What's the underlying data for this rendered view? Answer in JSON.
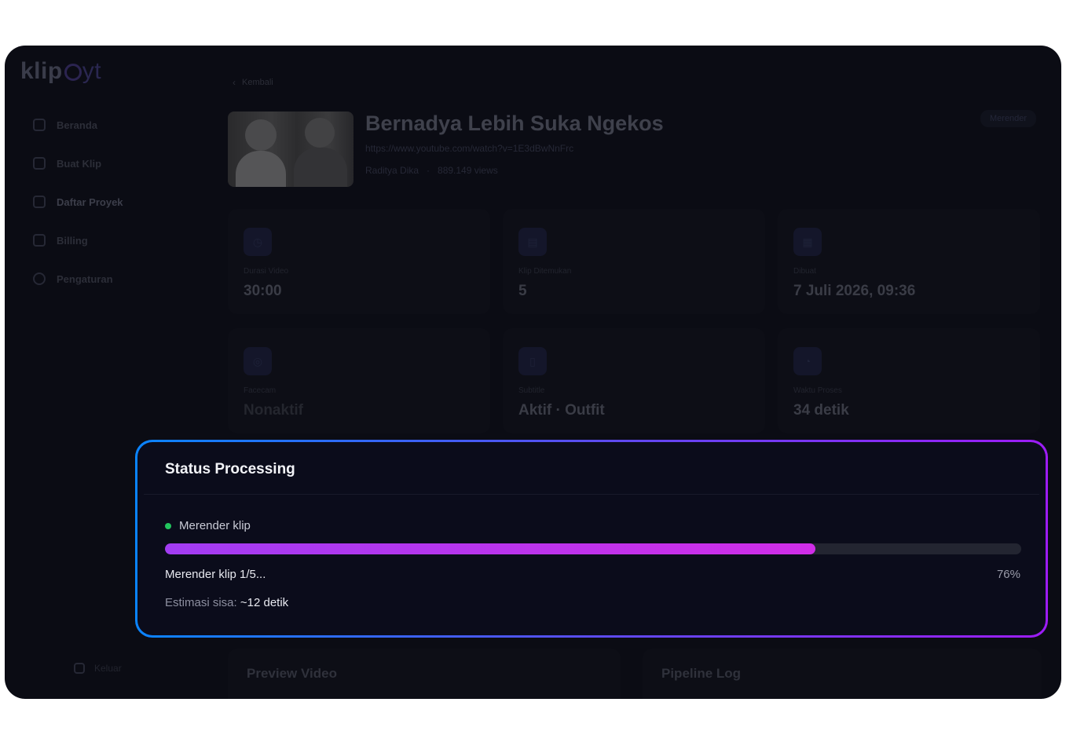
{
  "sidebar": {
    "logo_text": "klip",
    "logo_suffix": "yt",
    "items": [
      {
        "label": "Beranda",
        "icon": "home-icon"
      },
      {
        "label": "Buat Klip",
        "icon": "video-icon"
      },
      {
        "label": "Daftar Proyek",
        "icon": "folder-icon"
      },
      {
        "label": "Billing",
        "icon": "card-icon"
      },
      {
        "label": "Pengaturan",
        "icon": "gear-icon"
      }
    ],
    "logout_label": "Keluar"
  },
  "header": {
    "back_label": "Kembali",
    "video_title": "Bernadya Lebih Suka Ngekos",
    "video_url": "https://www.youtube.com/watch?v=1E3dBwNnFrc",
    "channel": "Raditya Dika",
    "views": "889.149 views",
    "status_badge": "Merender"
  },
  "stats": [
    {
      "label": "Durasi Video",
      "value": "30:00",
      "icon": "clock-icon"
    },
    {
      "label": "Klip Ditemukan",
      "value": "5",
      "icon": "film-icon"
    },
    {
      "label": "Dibuat",
      "value": "7 Juli 2026, 09:36",
      "icon": "calendar-icon"
    },
    {
      "label": "Facecam",
      "value": "Nonaktif",
      "icon": "camera-icon"
    },
    {
      "label": "Subtitle",
      "value": "Aktif · Outfit",
      "icon": "document-icon"
    },
    {
      "label": "Waktu Proses",
      "value": "34 detik",
      "icon": "timer-icon"
    }
  ],
  "panels": {
    "preview_title": "Preview Video",
    "log_title": "Pipeline Log"
  },
  "processing": {
    "title": "Status Processing",
    "stage_label": "Merender klip",
    "progress_percent": 76,
    "progress_text": "Merender klip 1/5...",
    "progress_pct_label": "76%",
    "eta_label": "Estimasi sisa:",
    "eta_value": "~12 detik",
    "colors": {
      "border_start": "#0a84ff",
      "border_end": "#9d1cf7",
      "fill_start": "#a23cf2",
      "fill_end": "#d02de8",
      "stage_dot": "#22c55e"
    }
  }
}
